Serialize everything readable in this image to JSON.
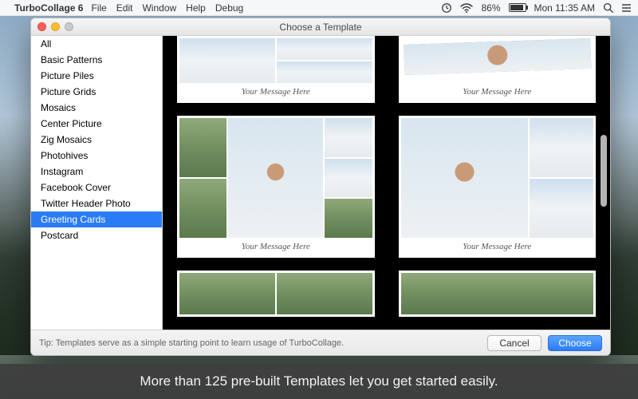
{
  "menubar": {
    "app_name": "TurboCollage 6",
    "items": [
      "File",
      "Edit",
      "Window",
      "Help",
      "Debug"
    ],
    "battery_percent": "86%",
    "clock": "Mon 11:35 AM"
  },
  "window": {
    "title": "Choose a Template"
  },
  "sidebar": {
    "items": [
      "All",
      "Basic Patterns",
      "Picture Piles",
      "Picture Grids",
      "Mosaics",
      "Center Picture",
      "Zig Mosaics",
      "Photohives",
      "Instagram",
      "Facebook Cover",
      "Twitter Header Photo",
      "Greeting Cards",
      "Postcard"
    ],
    "selected_index": 11
  },
  "templates": {
    "placeholder_caption": "Your Message Here"
  },
  "footer": {
    "tip": "Tip: Templates serve as a simple starting point to learn usage of TurboCollage.",
    "cancel": "Cancel",
    "choose": "Choose"
  },
  "caption": "More than 125 pre-built Templates let you get started easily."
}
